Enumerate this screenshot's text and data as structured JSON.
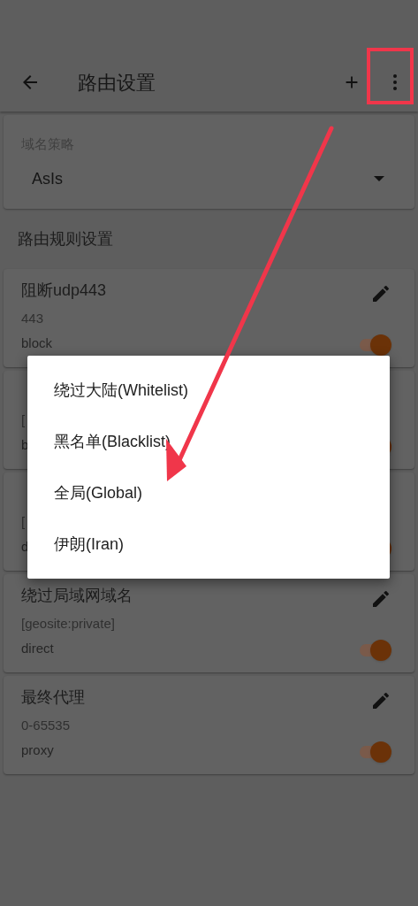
{
  "app_bar": {
    "title": "路由设置"
  },
  "domain_strategy": {
    "label": "域名策略",
    "value": "AsIs"
  },
  "section_title": "路由规则设置",
  "rules": [
    {
      "title": "阻断udp443",
      "detail": "443",
      "action": "block",
      "on": true
    },
    {
      "detail": "[",
      "action": "b",
      "on": true
    },
    {
      "detail": "[",
      "action": "d",
      "on": true
    },
    {
      "title": "绕过局域网域名",
      "detail": "[geosite:private]",
      "action": "direct",
      "on": true
    },
    {
      "title": "最终代理",
      "detail": "0-65535",
      "action": "proxy",
      "on": true
    }
  ],
  "menu": {
    "items": [
      "绕过大陆(Whitelist)",
      "黑名单(Blacklist)",
      "全局(Global)",
      "伊朗(Iran)"
    ]
  }
}
